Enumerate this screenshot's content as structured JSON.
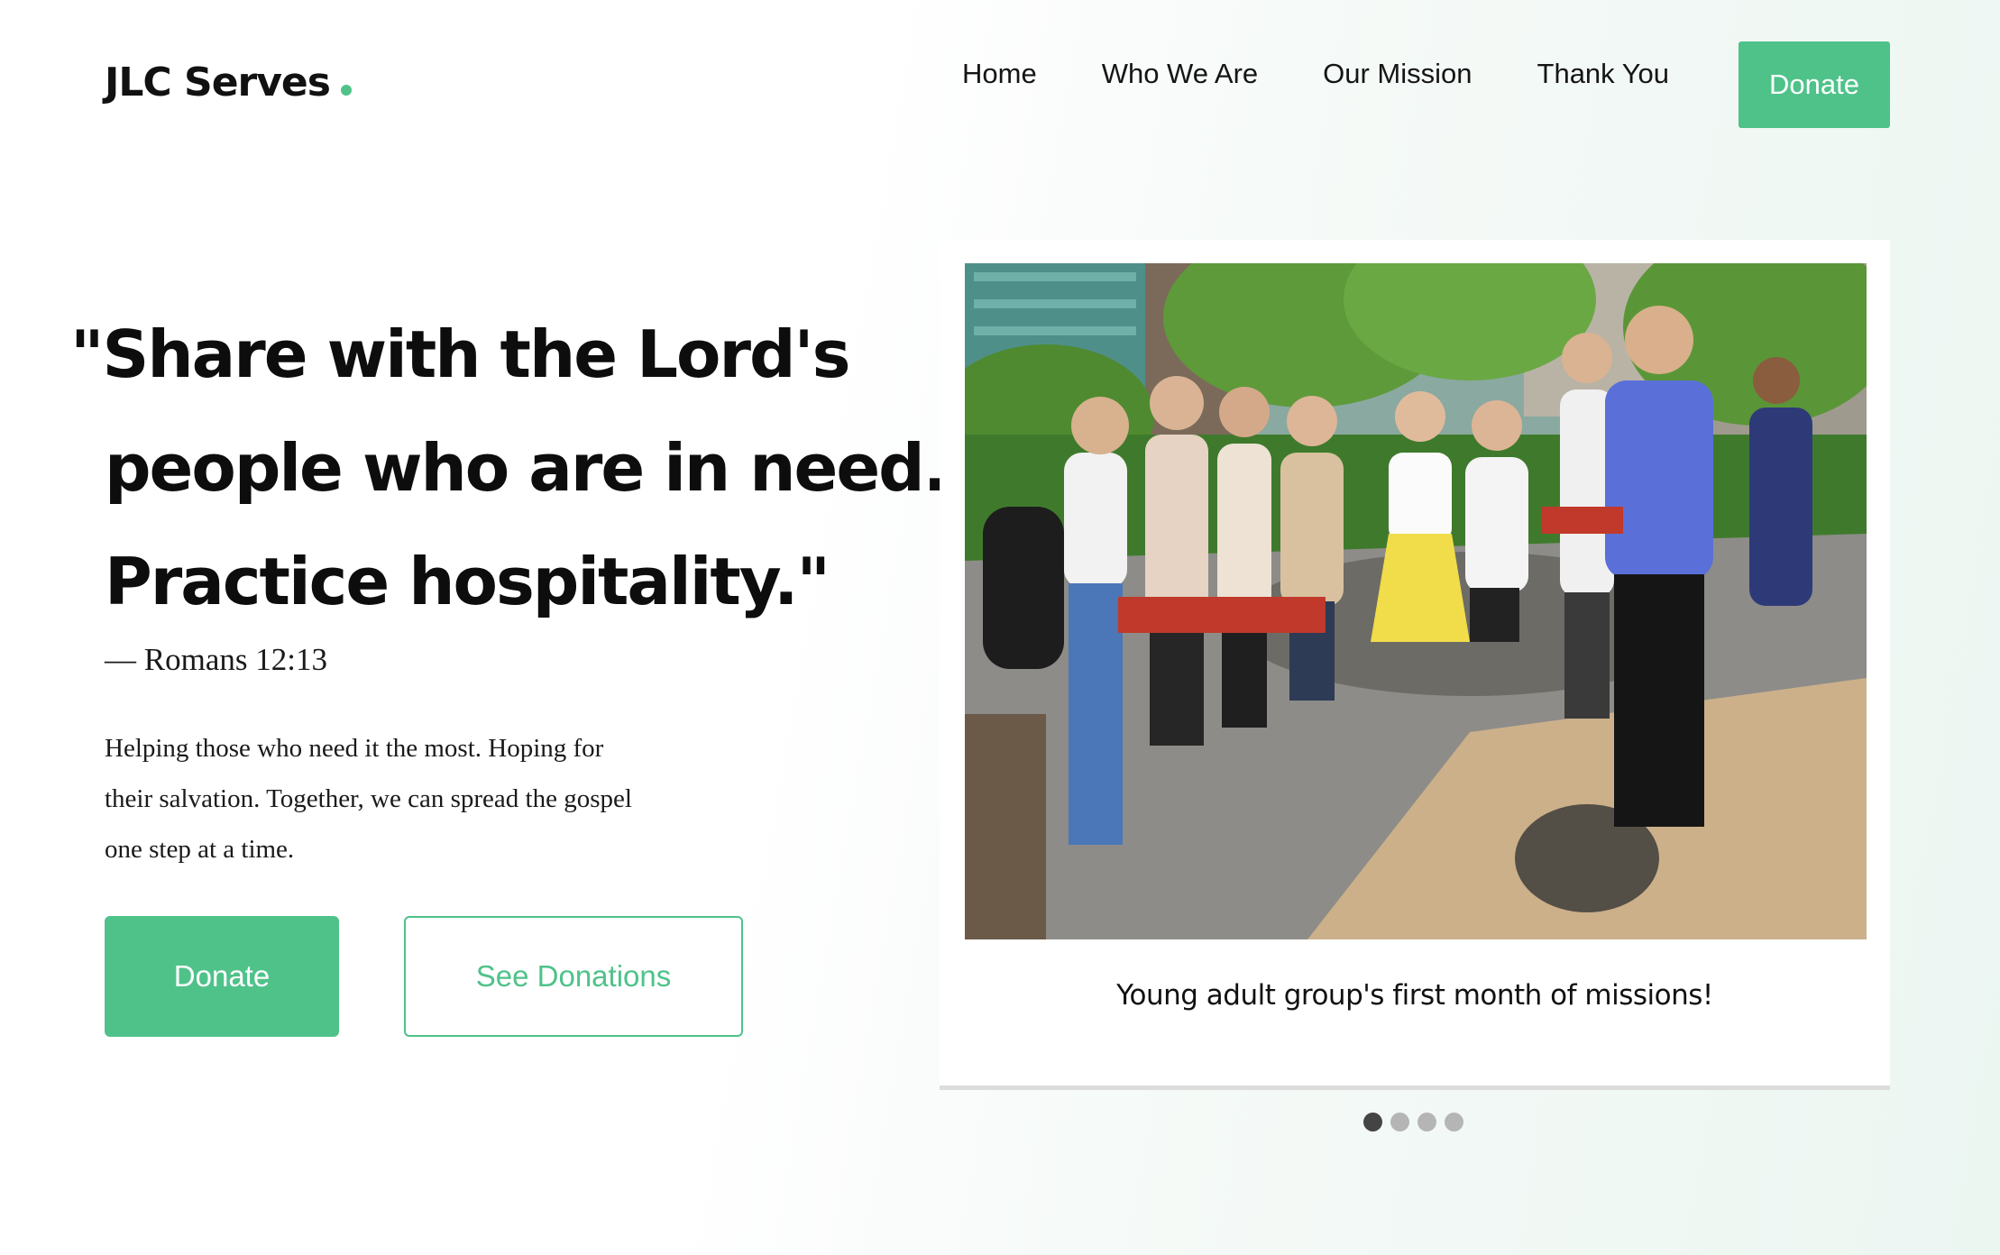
{
  "brand": {
    "name": "JLC Serves",
    "accent_color": "#4fc28a"
  },
  "nav": {
    "items": [
      {
        "label": "Home"
      },
      {
        "label": "Who We Are"
      },
      {
        "label": "Our Mission"
      },
      {
        "label": "Thank You"
      }
    ],
    "donate_label": "Donate"
  },
  "hero": {
    "quote_lines": [
      "\"Share with the Lord's",
      "people who are in need.",
      "Practice hospitality.\""
    ],
    "citation": "— Romans 12:13",
    "blurb_lines": [
      "Helping those who need it the most. Hoping for",
      "their salvation. Together, we can spread the gospel",
      "one step at a time."
    ],
    "primary_button": "Donate",
    "secondary_button": "See Donations"
  },
  "carousel": {
    "caption": "Young adult group's first month of missions!",
    "slide_count": 4,
    "active_index": 0,
    "dot_active_color": "#444444",
    "dot_inactive_color": "#b5b5b5"
  }
}
